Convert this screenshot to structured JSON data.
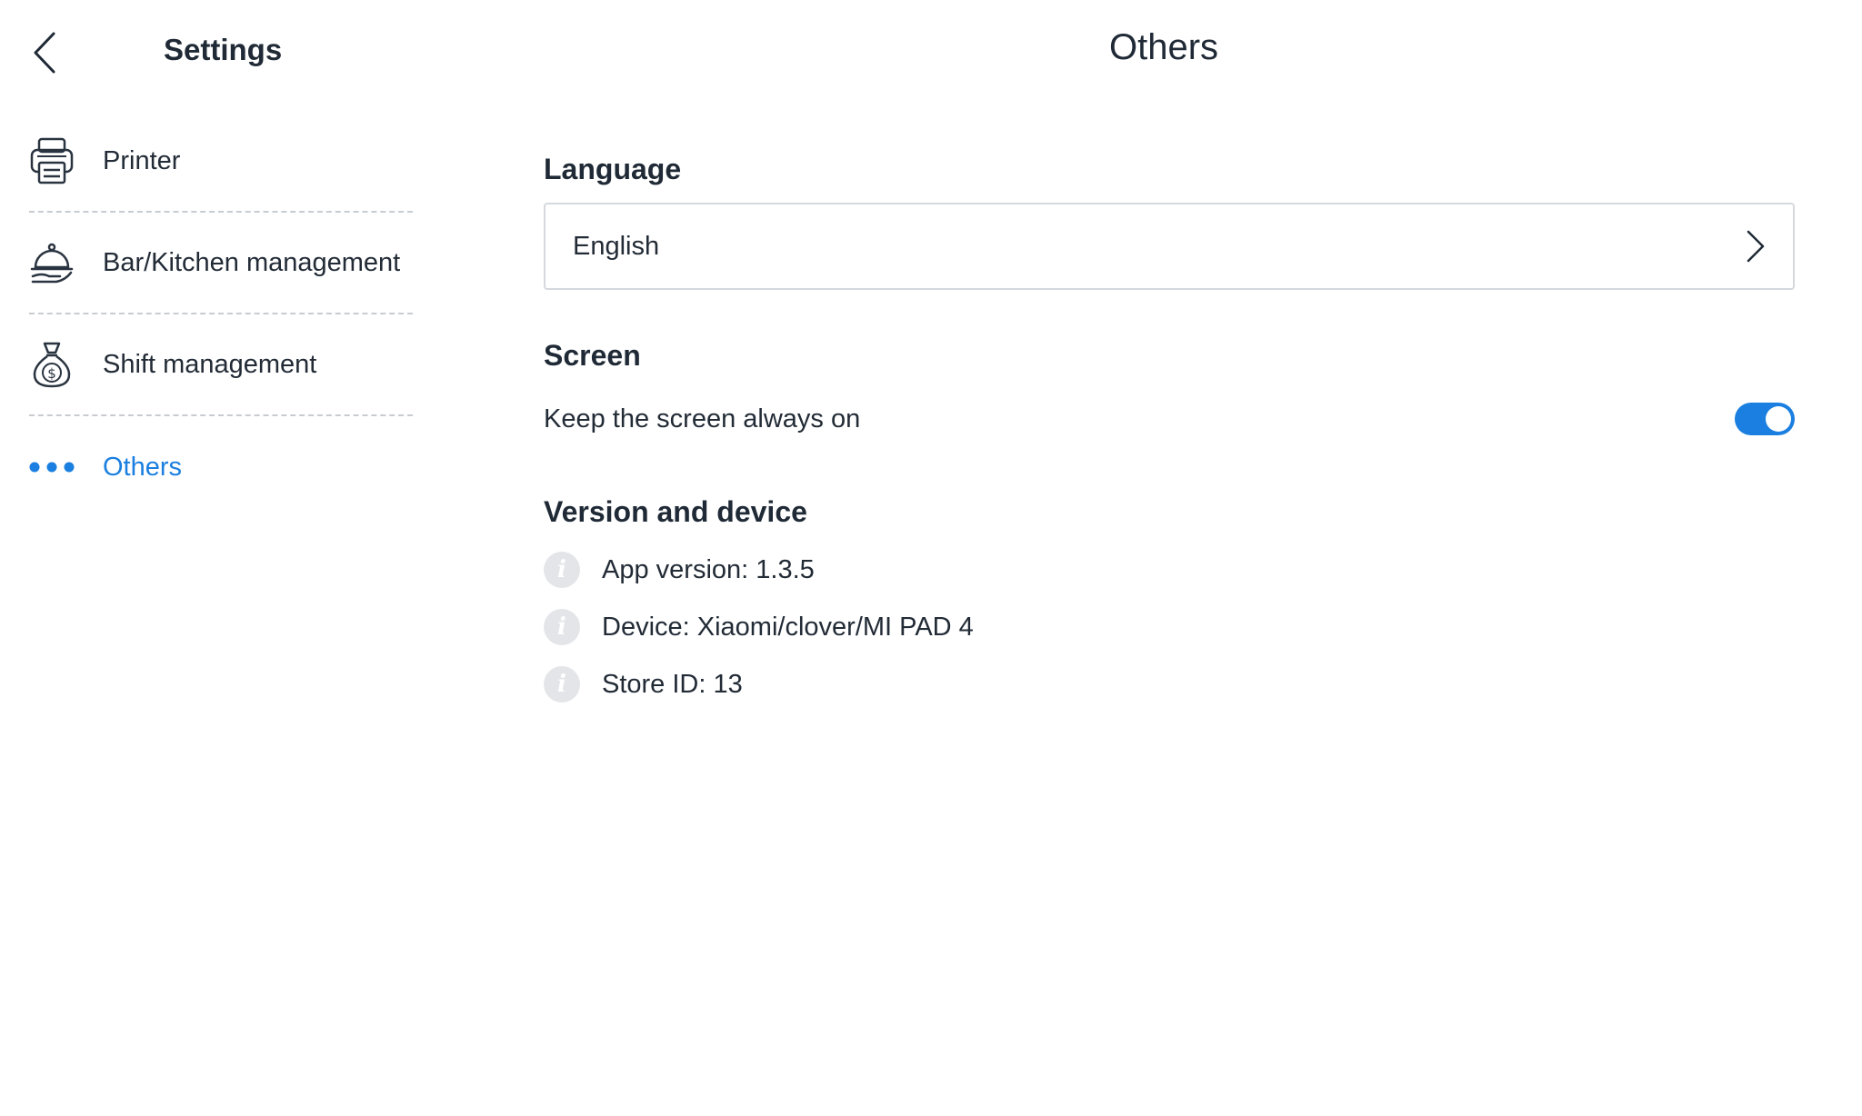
{
  "sidebar": {
    "title": "Settings",
    "back_icon": "chevron-left-icon",
    "items": [
      {
        "label": "Printer",
        "icon": "printer-icon",
        "active": false
      },
      {
        "label": "Bar/Kitchen management",
        "icon": "serving-cloche-icon",
        "active": false
      },
      {
        "label": "Shift management",
        "icon": "money-bag-icon",
        "active": false
      },
      {
        "label": "Others",
        "icon": "more-dots-icon",
        "active": true
      }
    ]
  },
  "header": {
    "title": "Others"
  },
  "main": {
    "language": {
      "title": "Language",
      "value": "English"
    },
    "screen": {
      "title": "Screen",
      "keep_on_label": "Keep the screen always on",
      "keep_on_enabled": true
    },
    "version": {
      "title": "Version and device",
      "items": [
        {
          "text": "App version: 1.3.5"
        },
        {
          "text": "Device: Xiaomi/clover/MI PAD 4"
        },
        {
          "text": "Store ID: 13"
        }
      ]
    }
  },
  "colors": {
    "accent": "#1a7fe0",
    "text": "#1f2a36",
    "divider": "#c8ccd1",
    "info_icon_bg": "#e3e5e8"
  }
}
